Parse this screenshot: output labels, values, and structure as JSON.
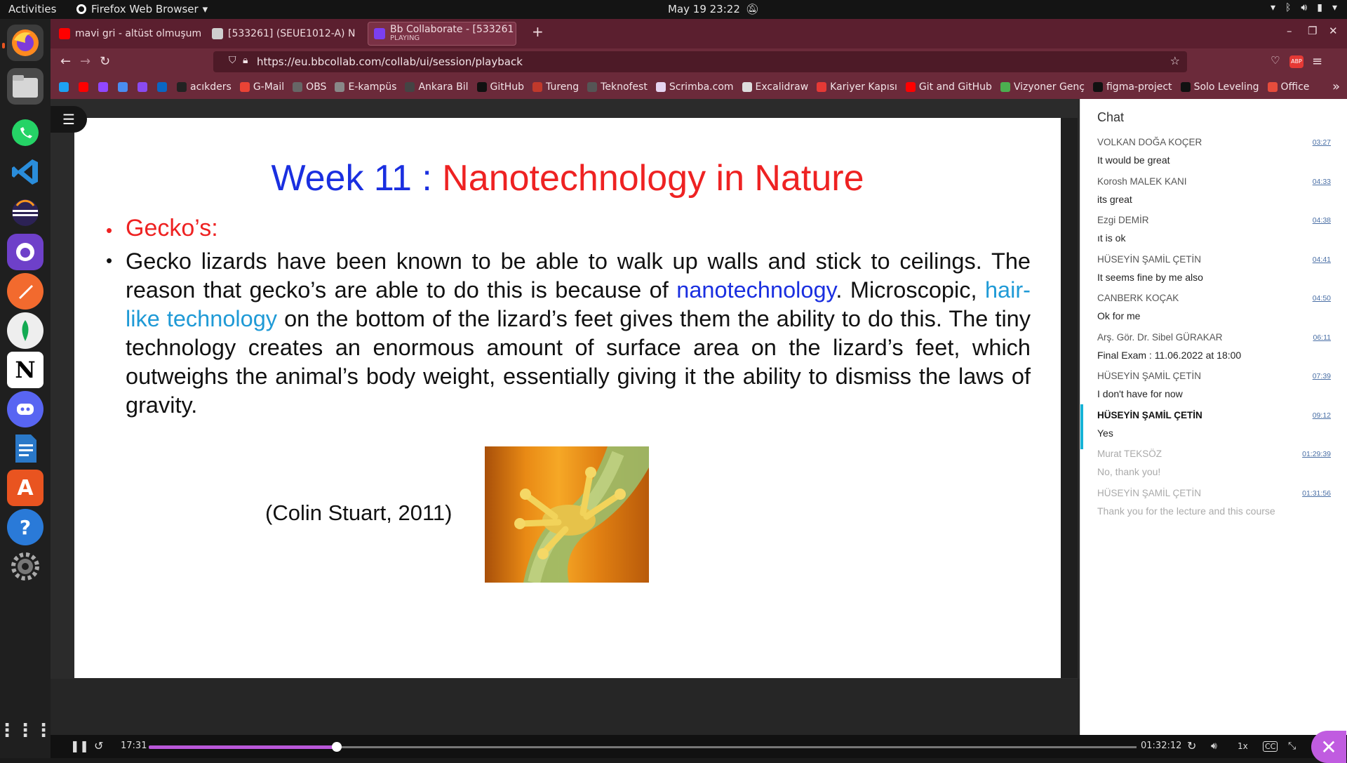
{
  "topbar": {
    "activities": "Activities",
    "app_name": "Firefox Web Browser",
    "clock": "May 19  23:22"
  },
  "tabs": [
    {
      "label": "mavi gri - altüst olmuşum",
      "color": "#ff0000"
    },
    {
      "label": "[533261] (SEUE1012-A) N",
      "color": "#cfcfcf"
    },
    {
      "label": "Bb Collaborate - [533261",
      "sub": "PLAYING",
      "color": "#7b3ff2"
    }
  ],
  "url": "https://eu.bbcollab.com/collab/ui/session/playback",
  "bookmarks": [
    {
      "label": "",
      "color": "#1da1f2"
    },
    {
      "label": "",
      "color": "#ff0000"
    },
    {
      "label": "",
      "color": "#9146ff"
    },
    {
      "label": "",
      "color": "#4a8df0"
    },
    {
      "label": "",
      "color": "#8a4af0"
    },
    {
      "label": "",
      "color": "#0a66c2"
    },
    {
      "label": "acıkders",
      "color": "#222"
    },
    {
      "label": "G-Mail",
      "color": "#ea4335"
    },
    {
      "label": "OBS",
      "color": "#666"
    },
    {
      "label": "E-kampüs",
      "color": "#888"
    },
    {
      "label": "Ankara Bil",
      "color": "#444"
    },
    {
      "label": "GitHub",
      "color": "#111"
    },
    {
      "label": "Tureng",
      "color": "#c0392b"
    },
    {
      "label": "Teknofest",
      "color": "#555"
    },
    {
      "label": "Scrimba.com",
      "color": "#e5d4f0"
    },
    {
      "label": "Excalidraw",
      "color": "#ddd"
    },
    {
      "label": "Kariyer Kapısı",
      "color": "#e53935"
    },
    {
      "label": "Git and GitHub",
      "color": "#ff0000"
    },
    {
      "label": "Vizyoner Genç",
      "color": "#4caf50"
    },
    {
      "label": "figma-project",
      "color": "#111"
    },
    {
      "label": "Solo Leveling",
      "color": "#111"
    },
    {
      "label": "Office",
      "color": "#e74c3c"
    }
  ],
  "slide": {
    "title_num": "Week 11 : ",
    "title_rest": "Nanotechnology in Nature",
    "bullet_heading": "Gecko’s:",
    "para_1": "Gecko lizards have been known to be able to walk up walls and stick to ceilings. The reason that gecko’s are able to do this is because of ",
    "para_link": "nanotechnology",
    "para_2": ". Microscopic, ",
    "para_link2": "hair-like technology",
    "para_3": " on the bottom of the lizard’s feet gives them the ability to do this. The tiny technology creates an enormous amount of surface area on the lizard’s feet, which outweighs the animal’s body weight, essentially giving it the ability to dismiss the laws of gravity.",
    "citation": "(Colin Stuart, 2011)"
  },
  "chat": {
    "title": "Chat",
    "messages": [
      {
        "who": "VOLKAN DOĞA KOÇER",
        "time": "03:27",
        "text": "It would be great"
      },
      {
        "who": "Korosh MALEK KANI",
        "time": "04:33",
        "text": "its great"
      },
      {
        "who": "Ezgi DEMİR",
        "time": "04:38",
        "text": "ıt is ok"
      },
      {
        "who": "HÜSEYİN ŞAMİL ÇETİN",
        "time": "04:41",
        "text": "It seems fine by me also"
      },
      {
        "who": "CANBERK KOÇAK",
        "time": "04:50",
        "text": "Ok for me"
      },
      {
        "who": "Arş. Gör. Dr. Sibel GÜRAKAR",
        "time": "06:11",
        "text": "Final Exam : 11.06.2022 at 18:00"
      },
      {
        "who": "HÜSEYİN ŞAMİL ÇETİN",
        "time": "07:39",
        "text": "I don't have for now"
      },
      {
        "who": "HÜSEYİN ŞAMİL ÇETİN",
        "time": "09:12",
        "text": "Yes"
      },
      {
        "who": "Murat TEKSÖZ",
        "time": "01:29:39",
        "text": "No, thank you!"
      },
      {
        "who": "HÜSEYİN ŞAMİL ÇETİN",
        "time": "01:31:56",
        "text": "Thank you for the lecture and this course"
      }
    ]
  },
  "player": {
    "current": "17:31",
    "total": "01:32:12",
    "speed": "1x",
    "progress": 0.19
  }
}
